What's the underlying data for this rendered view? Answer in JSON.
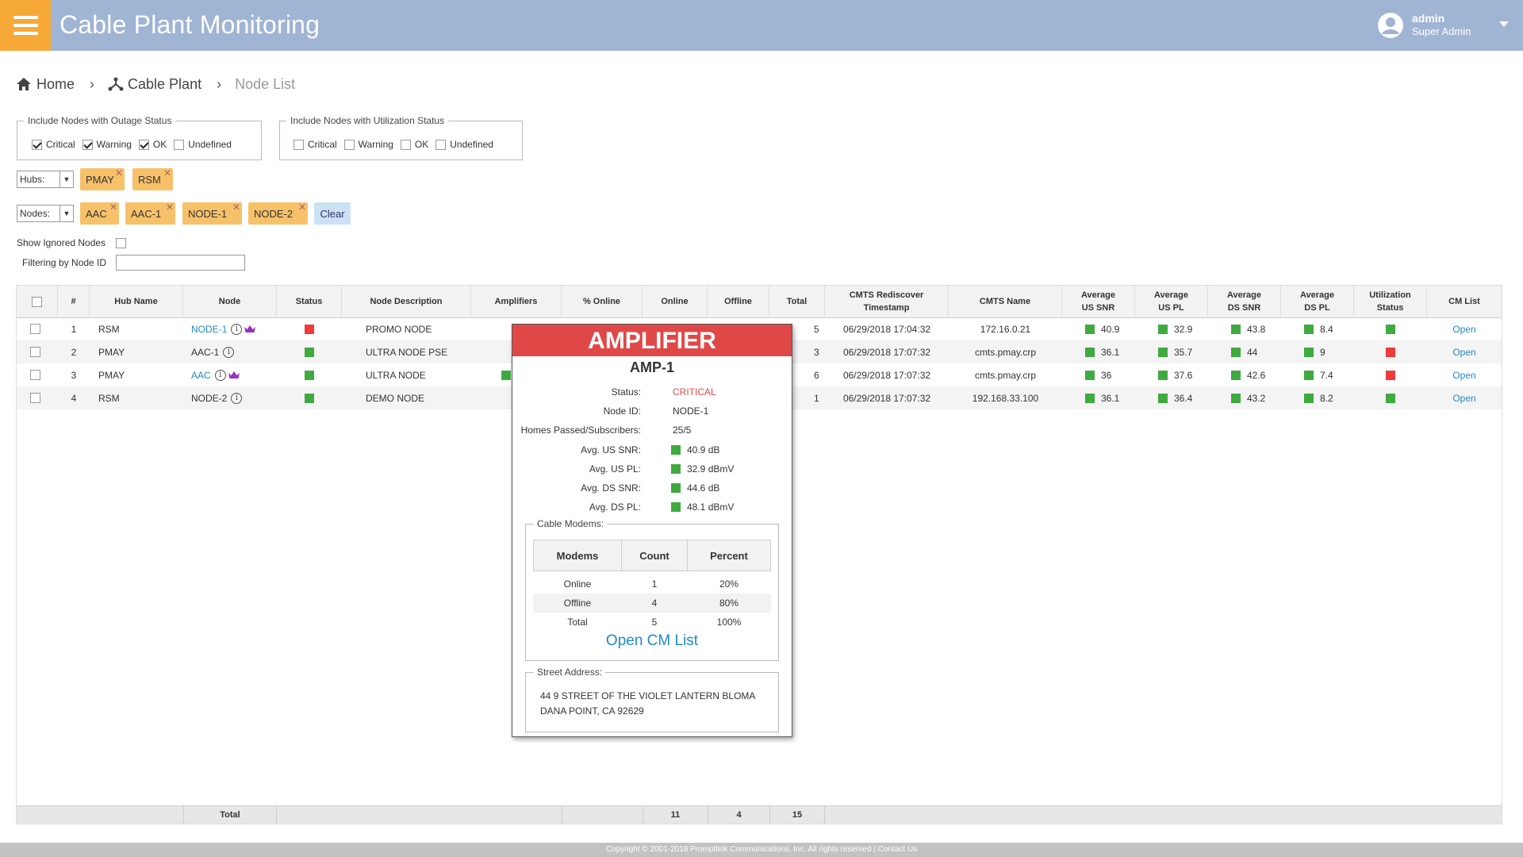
{
  "header": {
    "title": "Cable Plant Monitoring",
    "user_name": "admin",
    "user_role": "Super Admin"
  },
  "breadcrumb": {
    "home": "Home",
    "cable_plant": "Cable Plant",
    "current": "Node List"
  },
  "filters": {
    "outage": {
      "legend": "Include Nodes with Outage Status",
      "options": [
        {
          "label": "Critical",
          "checked": true
        },
        {
          "label": "Warning",
          "checked": true
        },
        {
          "label": "OK",
          "checked": true
        },
        {
          "label": "Undefined",
          "checked": false
        }
      ]
    },
    "utilization": {
      "legend": "Include Nodes with Utilization Status",
      "options": [
        {
          "label": "Critical",
          "checked": false
        },
        {
          "label": "Warning",
          "checked": false
        },
        {
          "label": "OK",
          "checked": false
        },
        {
          "label": "Undefined",
          "checked": false
        }
      ]
    },
    "hubs_label": "Hubs:",
    "hub_tags": [
      "PMAY",
      "RSM"
    ],
    "nodes_label": "Nodes:",
    "node_tags": [
      "AAC",
      "AAC-1",
      "NODE-1",
      "NODE-2"
    ],
    "clear_label": "Clear",
    "show_ignored_label": "Show Ignored Nodes",
    "filter_node_id_label": "Filtering by Node ID",
    "filter_node_id_value": ""
  },
  "table": {
    "columns": [
      "#",
      "Hub Name",
      "Node",
      "Status",
      "Node Description",
      "Amplifiers",
      "% Online",
      "Online",
      "Offline",
      "Total",
      "CMTS Rediscover Timestamp",
      "CMTS Name",
      "Average US SNR",
      "Average US PL",
      "Average DS SNR",
      "Average DS PL",
      "Utilization Status",
      "CM List"
    ],
    "rows": [
      {
        "num": "1",
        "hub": "RSM",
        "node": "NODE-1",
        "node_link": true,
        "crown": true,
        "status": "red",
        "desc": "PROMO NODE",
        "amp": "",
        "total": "5",
        "ts": "06/29/2018 17:04:32",
        "cmts": "172.16.0.21",
        "us_snr": "40.9",
        "us_pl": "32.9",
        "ds_snr": "43.8",
        "ds_pl": "8.4",
        "util": "green",
        "cm": "Open"
      },
      {
        "num": "2",
        "hub": "PMAY",
        "node": "AAC-1",
        "node_link": false,
        "crown": false,
        "status": "green",
        "desc": "ULTRA NODE PSE",
        "amp": "",
        "total": "3",
        "ts": "06/29/2018 17:07:32",
        "cmts": "cmts.pmay.crp",
        "us_snr": "36.1",
        "us_pl": "35.7",
        "ds_snr": "44",
        "ds_pl": "9",
        "util": "red",
        "cm": "Open"
      },
      {
        "num": "3",
        "hub": "PMAY",
        "node": "AAC",
        "node_link": true,
        "crown": true,
        "status": "green",
        "desc": "ULTRA NODE",
        "amp": "green",
        "total": "6",
        "ts": "06/29/2018 17:07:32",
        "cmts": "cmts.pmay.crp",
        "us_snr": "36",
        "us_pl": "37.6",
        "ds_snr": "42.6",
        "ds_pl": "7.4",
        "util": "red",
        "cm": "Open"
      },
      {
        "num": "4",
        "hub": "RSM",
        "node": "NODE-2",
        "node_link": false,
        "crown": false,
        "status": "green",
        "desc": "DEMO NODE",
        "amp": "",
        "total": "1",
        "ts": "06/29/2018 17:07:32",
        "cmts": "192.168.33.100",
        "us_snr": "36.1",
        "us_pl": "36.4",
        "ds_snr": "43.2",
        "ds_pl": "8.2",
        "util": "green",
        "cm": "Open"
      }
    ],
    "footer": {
      "label": "Total",
      "online": "11",
      "offline": "4",
      "total": "15"
    }
  },
  "popup": {
    "title": "AMPLIFIER",
    "name": "AMP-1",
    "fields": [
      {
        "key": "Status:",
        "value": "CRITICAL",
        "indicator": "",
        "critical": true
      },
      {
        "key": "Node ID:",
        "value": "NODE-1",
        "indicator": ""
      },
      {
        "key": "Homes Passed/Subscribers:",
        "value": "25/5",
        "indicator": ""
      },
      {
        "key": "Avg. US SNR:",
        "value": "40.9 dB",
        "indicator": "green"
      },
      {
        "key": "Avg. US PL:",
        "value": "32.9 dBmV",
        "indicator": "green"
      },
      {
        "key": "Avg. DS SNR:",
        "value": "44.6 dB",
        "indicator": "green"
      },
      {
        "key": "Avg. DS PL:",
        "value": "48.1 dBmV",
        "indicator": "green"
      }
    ],
    "cable_modems": {
      "legend": "Cable Modems:",
      "headers": [
        "Modems",
        "Count",
        "Percent"
      ],
      "rows": [
        [
          "Online",
          "1",
          "20%"
        ],
        [
          "Offline",
          "4",
          "80%"
        ],
        [
          "Total",
          "5",
          "100%"
        ]
      ],
      "open_label": "Open CM List"
    },
    "address": {
      "legend": "Street Address:",
      "line1": "44 9 STREET OF THE VIOLET LANTERN BLOMA",
      "line2": "DANA POINT, CA 92629"
    }
  },
  "footer_text": "Copyright © 2001-2018 Promptlink Communications, Inc. All rights reserved | Contact Us",
  "colors": {
    "header": "#a0b4d4",
    "accent": "#f7a937",
    "critical": "#ef3b3b",
    "ok": "#3faa3f",
    "link": "#1e88c8"
  }
}
